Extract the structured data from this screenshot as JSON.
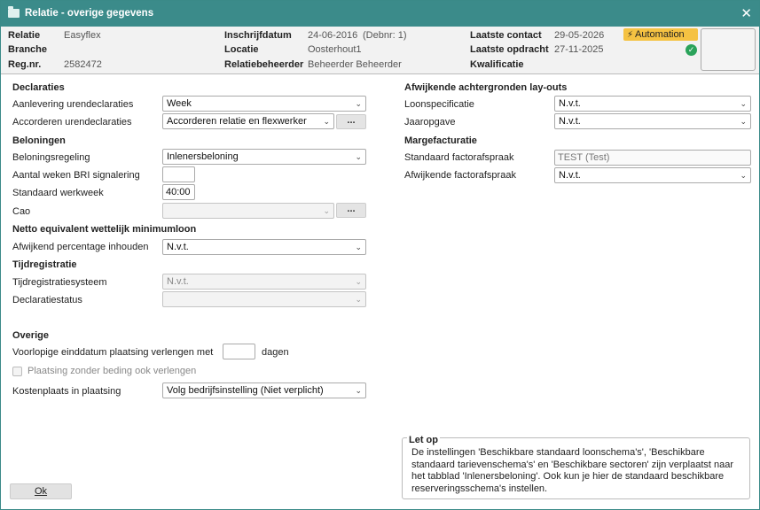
{
  "window": {
    "title": "Relatie - overige gegevens",
    "close": "✕"
  },
  "header": {
    "relatie_label": "Relatie",
    "relatie_value": "Easyflex",
    "branche_label": "Branche",
    "branche_value": "",
    "regnr_label": "Reg.nr.",
    "regnr_value": "2582472",
    "inschrijf_label": "Inschrijfdatum",
    "inschrijf_value": "24-06-2016",
    "debnr": "(Debnr: 1)",
    "locatie_label": "Locatie",
    "locatie_value": "Oosterhout1",
    "beheerder_label": "Relatiebeheerder",
    "beheerder_value": "Beheerder Beheerder",
    "contact_label": "Laatste contact",
    "contact_value": "29-05-2026",
    "opdracht_label": "Laatste opdracht",
    "opdracht_value": "27-11-2025",
    "kwal_label": "Kwalificatie",
    "badge": "Automation",
    "check": "✓"
  },
  "left": {
    "declaraties": "Declaraties",
    "aanlevering_label": "Aanlevering urendeclaraties",
    "aanlevering_value": "Week",
    "accorderen_label": "Accorderen urendeclaraties",
    "accorderen_value": "Accorderen relatie en flexwerker",
    "dots": "...",
    "beloningen": "Beloningen",
    "beloningsregeling_label": "Beloningsregeling",
    "beloningsregeling_value": "Inlenersbeloning",
    "bri_label": "Aantal weken BRI signalering",
    "bri_value": "",
    "werkweek_label": "Standaard werkweek",
    "werkweek_value": "40:00",
    "cao_label": "Cao",
    "cao_value": "",
    "netto": "Netto equivalent wettelijk minimumloon",
    "afwijkend_label": "Afwijkend percentage inhouden",
    "afwijkend_value": "N.v.t.",
    "tijdregistratie": "Tijdregistratie",
    "tijdsysteem_label": "Tijdregistratiesysteem",
    "tijdsysteem_value": "N.v.t.",
    "declstatus_label": "Declaratiestatus",
    "declstatus_value": "",
    "overige": "Overige",
    "voorlopige_label": "Voorlopige einddatum plaatsing verlengen met",
    "voorlopige_value": "",
    "dagen": "dagen",
    "zonder_label": "Plaatsing zonder beding ook verlengen",
    "kostenplaats_label": "Kostenplaats in plaatsing",
    "kostenplaats_value": "Volg bedrijfsinstelling (Niet verplicht)"
  },
  "right": {
    "achtergronden": "Afwijkende achtergronden lay-outs",
    "loonspec_label": "Loonspecificatie",
    "loonspec_value": "N.v.t.",
    "jaaropgave_label": "Jaaropgave",
    "jaaropgave_value": "N.v.t.",
    "margefacturatie": "Margefacturatie",
    "factuur_label": "Standaard factorafspraak",
    "factuur_value": "TEST (Test)",
    "afwfact_label": "Afwijkende factorafspraak",
    "afwfact_value": "N.v.t."
  },
  "note": {
    "title": "Let op",
    "body": "De instellingen 'Beschikbare standaard loonschema's', 'Beschikbare standaard tarievenschema's' en 'Beschikbare sectoren' zijn verplaatst naar het tabblad 'Inlenersbeloning'. Ook kun je hier de standaard beschikbare reserveringsschema's instellen."
  },
  "footer": {
    "ok": "Ok"
  },
  "icons": {
    "chevron": "chevron-down-icon",
    "bolt": "bolt-icon",
    "folder": "folder-icon",
    "check": "check-icon"
  },
  "colors": {
    "title_bar": "#3b8b8a",
    "badge": "#f5c242",
    "check": "#2aa35a"
  }
}
